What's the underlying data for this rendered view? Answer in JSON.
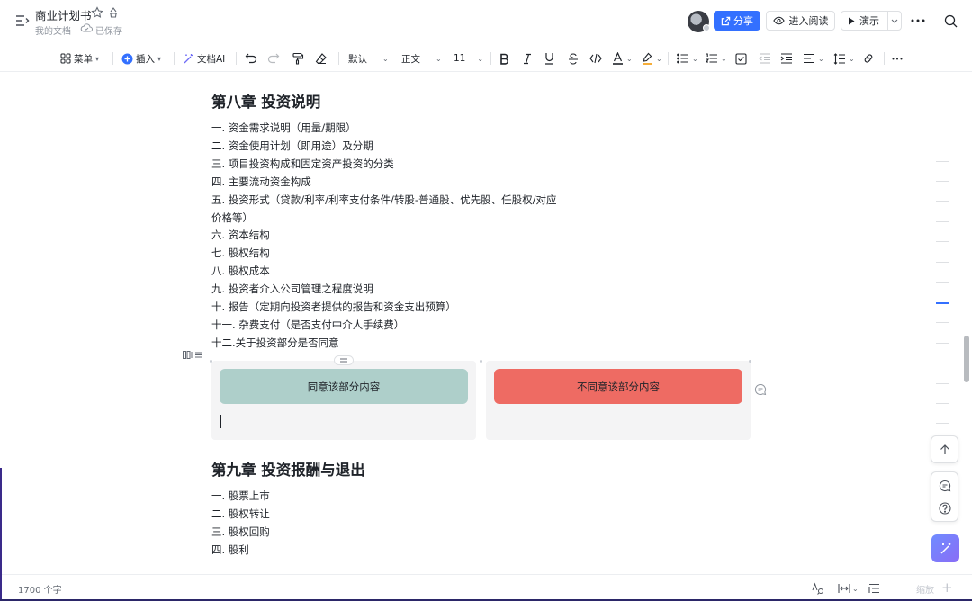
{
  "header": {
    "title": "商业计划书",
    "location": "我的文档",
    "save_status": "已保存",
    "share_label": "分享",
    "read_label": "进入阅读",
    "present_label": "演示"
  },
  "toolbar": {
    "menu_label": "菜单",
    "insert_label": "插入",
    "ai_label": "文档AI",
    "font_label": "默认",
    "style_label": "正文",
    "size_label": "11"
  },
  "chapter8": {
    "heading": "第八章 投资说明",
    "items": [
      "一. 资金需求说明（用量/期限）",
      "二. 资金使用计划（即用途）及分期",
      "三. 项目投资构成和固定资产投资的分类",
      "四. 主要流动资金构成",
      "五. 投资形式（贷款/利率/利率支付条件/转股-普通股、优先股、任股权/对应",
      "价格等）",
      "六. 资本结构",
      "七. 股权结构",
      "八. 股权成本",
      "九. 投资者介入公司管理之程度说明",
      "十. 报告（定期向投资者提供的报告和资金支出预算）",
      "十一. 杂费支付（是否支付中介人手续费）",
      "十二.关于投资部分是否同意"
    ]
  },
  "choices": {
    "agree_label": "同意该部分内容",
    "disagree_label": "不同意该部分内容",
    "agree_color": "#aecfca",
    "disagree_color": "#ee6b63"
  },
  "chapter9": {
    "heading": "第九章 投资报酬与退出",
    "items": [
      "一. 股票上市",
      "二. 股权转让",
      "三. 股权回购",
      "四. 股利"
    ]
  },
  "status": {
    "word_count": "1700 个字",
    "zoom_label": "缩放"
  },
  "colors": {
    "accent": "#3370ff",
    "ai_gradient_start": "#6f8cff",
    "ai_gradient_end": "#8a6cf6"
  }
}
